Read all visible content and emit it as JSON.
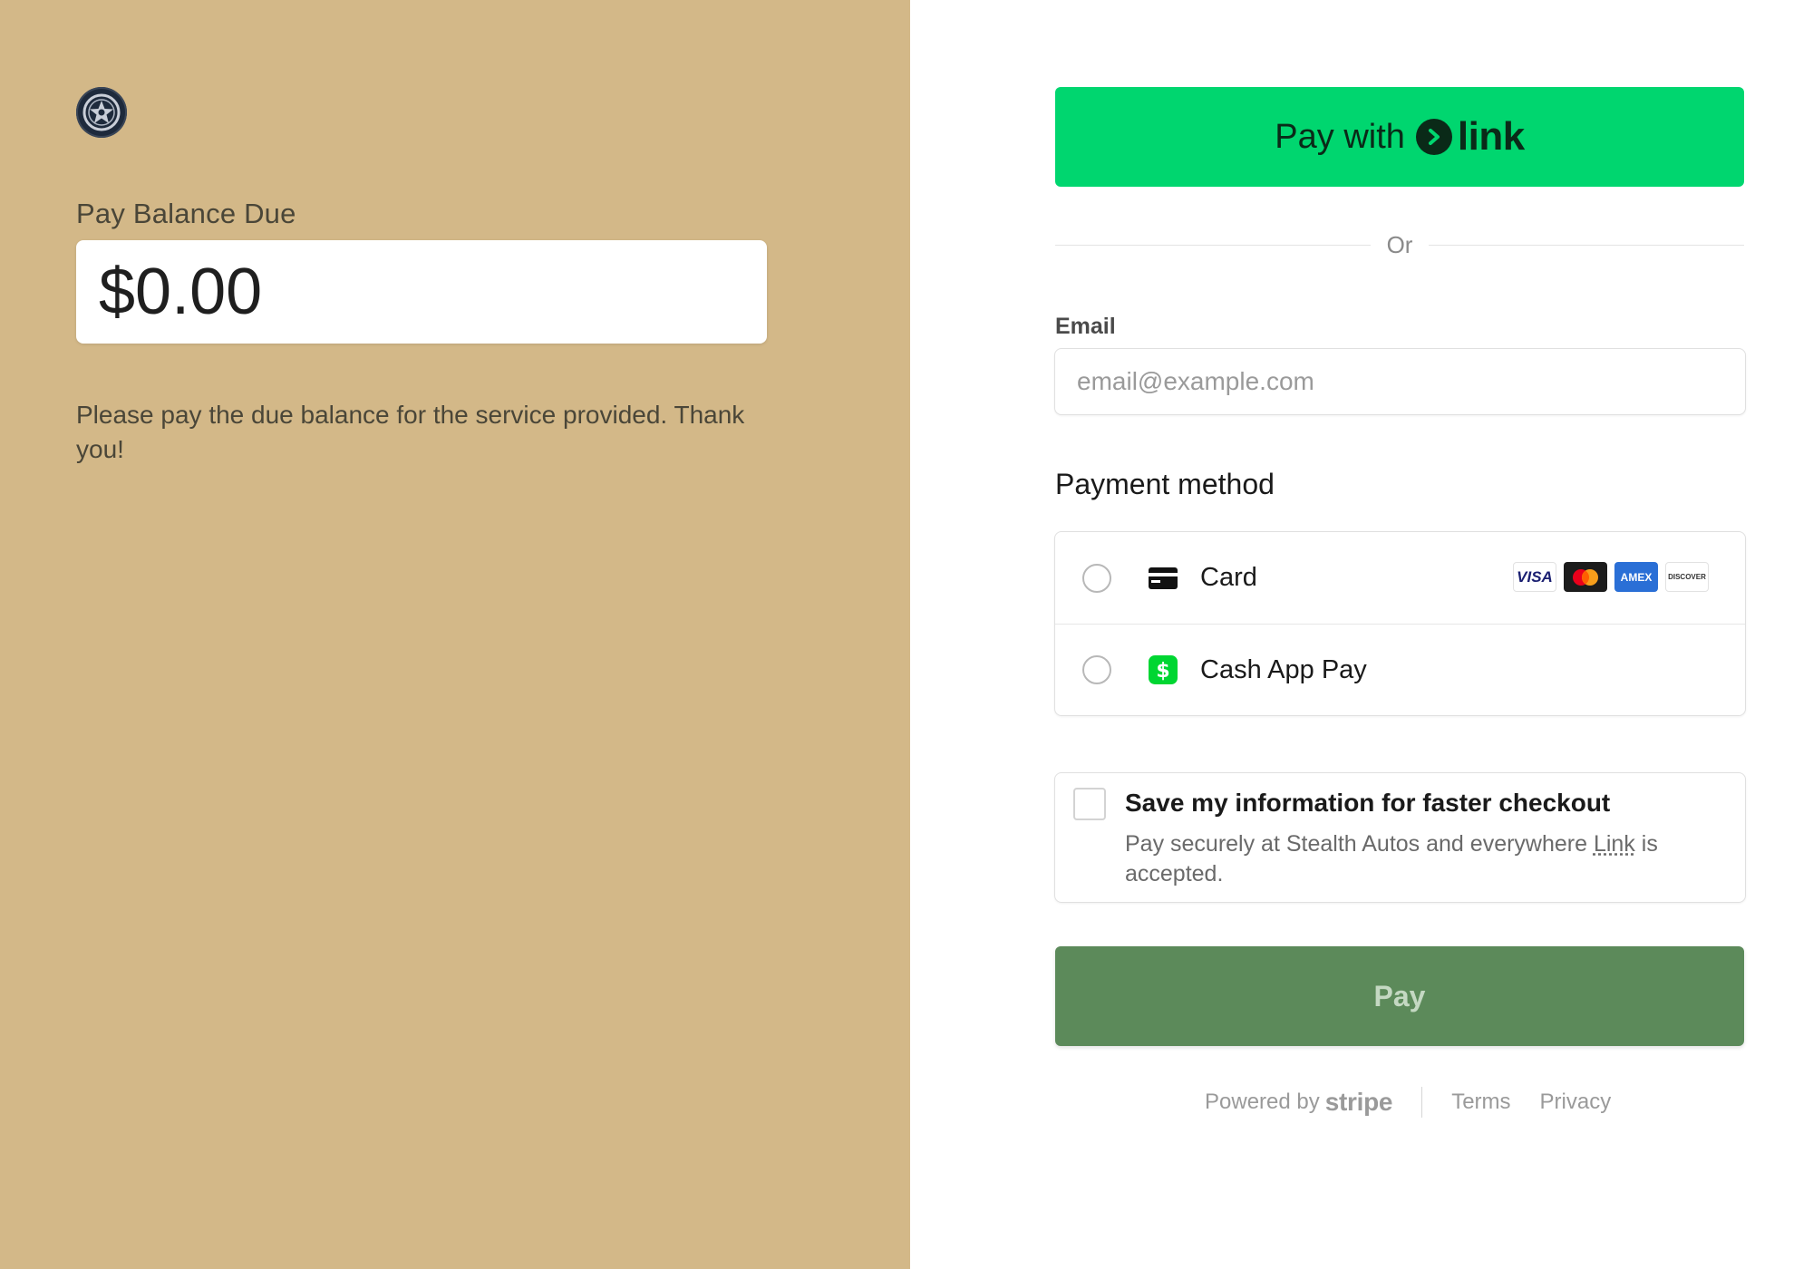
{
  "merchant": {
    "logo_icon": "wheel-icon"
  },
  "summary": {
    "balance_label": "Pay Balance Due",
    "amount": "$0.00",
    "description": "Please pay the due balance for the service provided. Thank you!"
  },
  "link_button": {
    "prefix": "Pay with",
    "brand": "link",
    "color": "#00d66f"
  },
  "divider": {
    "label": "Or"
  },
  "email": {
    "label": "Email",
    "placeholder": "email@example.com",
    "value": ""
  },
  "payment_method": {
    "title": "Payment method",
    "options": [
      {
        "label": "Card",
        "icon": "credit-card-icon",
        "brands": [
          "VISA",
          "mastercard",
          "AMEX",
          "DISCOVER"
        ]
      },
      {
        "label": "Cash App Pay",
        "icon": "cash-app-icon"
      }
    ]
  },
  "save_info": {
    "title": "Save my information for faster checkout",
    "desc_before": "Pay securely at Stealth Autos and everywhere ",
    "desc_link": "Link",
    "desc_after": " is accepted."
  },
  "pay_button": {
    "label": "Pay",
    "color": "#5c8a5a"
  },
  "footer": {
    "powered_by": "Powered by",
    "stripe": "stripe",
    "terms": "Terms",
    "privacy": "Privacy"
  }
}
